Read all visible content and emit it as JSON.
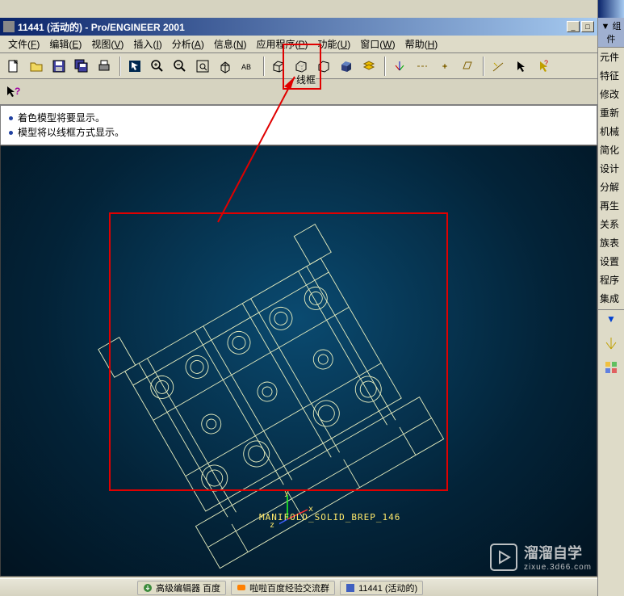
{
  "title": "11441 (活动的) - Pro/ENGINEER 2001",
  "window_buttons": {
    "min": "_",
    "max": "□"
  },
  "menu": [
    {
      "label": "文件",
      "key": "F"
    },
    {
      "label": "编辑",
      "key": "E"
    },
    {
      "label": "视图",
      "key": "V"
    },
    {
      "label": "插入",
      "key": "I"
    },
    {
      "label": "分析",
      "key": "A"
    },
    {
      "label": "信息",
      "key": "N"
    },
    {
      "label": "应用程序",
      "key": "P"
    },
    {
      "label": "功能",
      "key": "U"
    },
    {
      "label": "窗口",
      "key": "W"
    },
    {
      "label": "帮助",
      "key": "H"
    }
  ],
  "highlight_tooltip": "线框",
  "messages": [
    "着色模型将要显示。",
    "模型将以线框方式显示。"
  ],
  "model_label": "MANIFOLD_SOLID_BREP_146",
  "csys": {
    "x": "x",
    "y": "y",
    "z": "z"
  },
  "side_panel": {
    "head": "▼ 组件",
    "items": [
      "元件",
      "特征",
      "修改",
      "重新",
      "机械",
      "简化",
      "设计",
      "分解",
      "再生",
      "关系",
      "族表",
      "设置",
      "程序",
      "集成"
    ],
    "arrow": "▼"
  },
  "watermark": {
    "big": "溜溜自学",
    "small": "zixue.3d66.com"
  },
  "taskbar": [
    {
      "icon": "dl",
      "label": "高级编辑器  百度",
      "color": "#3a8a3a"
    },
    {
      "icon": "bd",
      "label": "啦啦百度经验交流群",
      "color": "#ff8000"
    },
    {
      "icon": "pe",
      "label": "11441 (活动的)",
      "color": "#4060c0"
    }
  ],
  "tb": {
    "new": "new-icon",
    "open": "open-icon",
    "save": "save-icon",
    "saveas": "saveas-icon",
    "print": "print-icon",
    "sel": "select-icon",
    "zin": "zoom-in-icon",
    "zout": "zoom-out-icon",
    "fit": "fit-icon",
    "orient": "orient-icon",
    "abc": "abc-icon",
    "wf": "wireframe-icon",
    "hl": "hidden-line-icon",
    "nh": "no-hidden-icon",
    "sh": "shaded-icon",
    "lay": "layers-icon",
    "c1": "csys-icon",
    "c2": "axis-icon",
    "c3": "point-icon",
    "c4": "plane-icon",
    "c5": "annot-icon",
    "c6": "arrow-icon",
    "c7": "help-arrow-icon",
    "help": "help-icon"
  }
}
